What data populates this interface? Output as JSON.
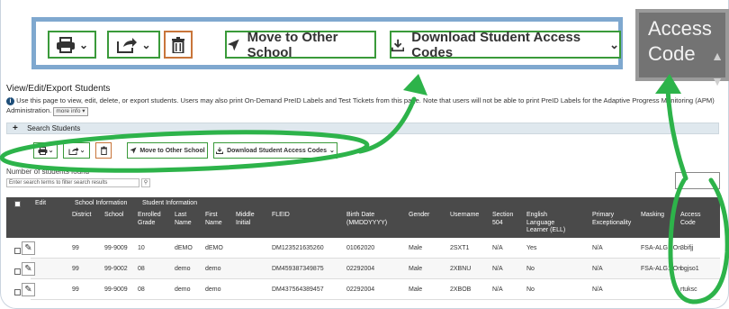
{
  "zoom_toolbar": {
    "move_label": "Move to Other School",
    "download_label": "Download Student Access Codes"
  },
  "zoom_access": {
    "line1": "Access",
    "line2": "Code"
  },
  "page": {
    "title": "View/Edit/Export Students",
    "note": "Use this page to view, edit, delete, or export students. Users may also print On-Demand PreID Labels and Test Tickets from this page. Note that users will not be able to print PreID Labels for the Adaptive Progress Monitoring (APM) Administration.",
    "more_info": "more info",
    "search_label": "Search Students",
    "num_students_label": "Number of students found",
    "filter_placeholder": "Enter search terms to filter search results"
  },
  "small_toolbar": {
    "move_label": "Move to Other School",
    "download_label": "Download Student Access Codes"
  },
  "table": {
    "group_headers": {
      "edit": "Edit",
      "school_info": "School Information",
      "student_info": "Student Information"
    },
    "columns": [
      "District",
      "School",
      "Enrolled Grade",
      "Last Name",
      "First Name",
      "Middle Initial",
      "FLEID",
      "Birth Date (MMDDYYYY)",
      "Gender",
      "Username",
      "Section 504",
      "English Language Learner (ELL)",
      "Primary Exceptionality",
      "Masking",
      "Access Code"
    ],
    "rows": [
      {
        "district": "99",
        "school": "99-9009",
        "grade": "10",
        "last": "dEMO",
        "first": "dEMO",
        "middle": "",
        "fleid": "DM123521635260",
        "birth": "01062020",
        "gender": "Male",
        "username": "2SXT1",
        "s504": "N/A",
        "ell": "Yes",
        "pe": "N/A",
        "masking": "FSA-ALG1:On",
        "code": "3bifjj"
      },
      {
        "district": "99",
        "school": "99-9002",
        "grade": "08",
        "last": "demo",
        "first": "demo",
        "middle": "",
        "fleid": "DM459387349875",
        "birth": "02292004",
        "gender": "Male",
        "username": "2XBNU",
        "s504": "N/A",
        "ell": "No",
        "pe": "N/A",
        "masking": "FSA-ALG1:On",
        "code": "bgjso1"
      },
      {
        "district": "99",
        "school": "99-9009",
        "grade": "08",
        "last": "demo",
        "first": "demo",
        "middle": "",
        "fleid": "DM437564389457",
        "birth": "02292004",
        "gender": "Male",
        "username": "2XBOB",
        "s504": "N/A",
        "ell": "No",
        "pe": "N/A",
        "masking": "",
        "code": "rtuksc"
      }
    ]
  },
  "colors": {
    "green_border": "#3a9a3a",
    "trash_border": "#c8753a",
    "callout_blue": "#7fa8cf",
    "arrow_green": "#2db34a",
    "header_dark": "#4a4a4a"
  }
}
